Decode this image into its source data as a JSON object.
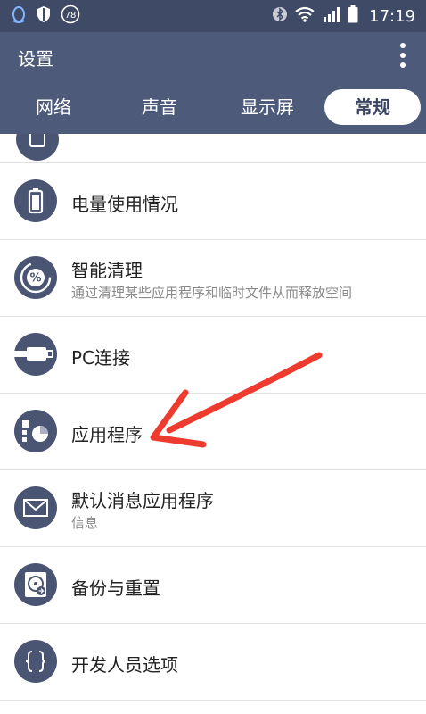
{
  "status_bar": {
    "time": "17:19",
    "badge_count": "78",
    "icons": [
      "qq-icon",
      "shield-icon",
      "badge-78-icon",
      "bluetooth-icon",
      "wifi-icon",
      "signal-icon",
      "battery-icon"
    ]
  },
  "app_bar": {
    "title": "设置"
  },
  "tabs": [
    {
      "label": "网络"
    },
    {
      "label": "声音"
    },
    {
      "label": "显示屏"
    },
    {
      "label": "常规",
      "active": true
    }
  ],
  "items": [
    {
      "label": "电量使用情况",
      "icon": "battery-icon"
    },
    {
      "label": "智能清理",
      "subtitle": "通过清理某些应用程序和临时文件从而释放空间",
      "icon": "smart-clean-icon"
    },
    {
      "label": "PC连接",
      "icon": "usb-cable-icon"
    },
    {
      "label": "应用程序",
      "icon": "apps-icon"
    },
    {
      "label": "默认消息应用程序",
      "subtitle": "信息",
      "icon": "message-icon"
    },
    {
      "label": "备份与重置",
      "icon": "backup-icon"
    },
    {
      "label": "开发人员选项",
      "icon": "braces-icon"
    }
  ],
  "colors": {
    "status_bar": "#3f4a66",
    "app_bar": "#4d5a7a",
    "icon_circle": "#4a5574",
    "arrow": "#ee3b30"
  }
}
